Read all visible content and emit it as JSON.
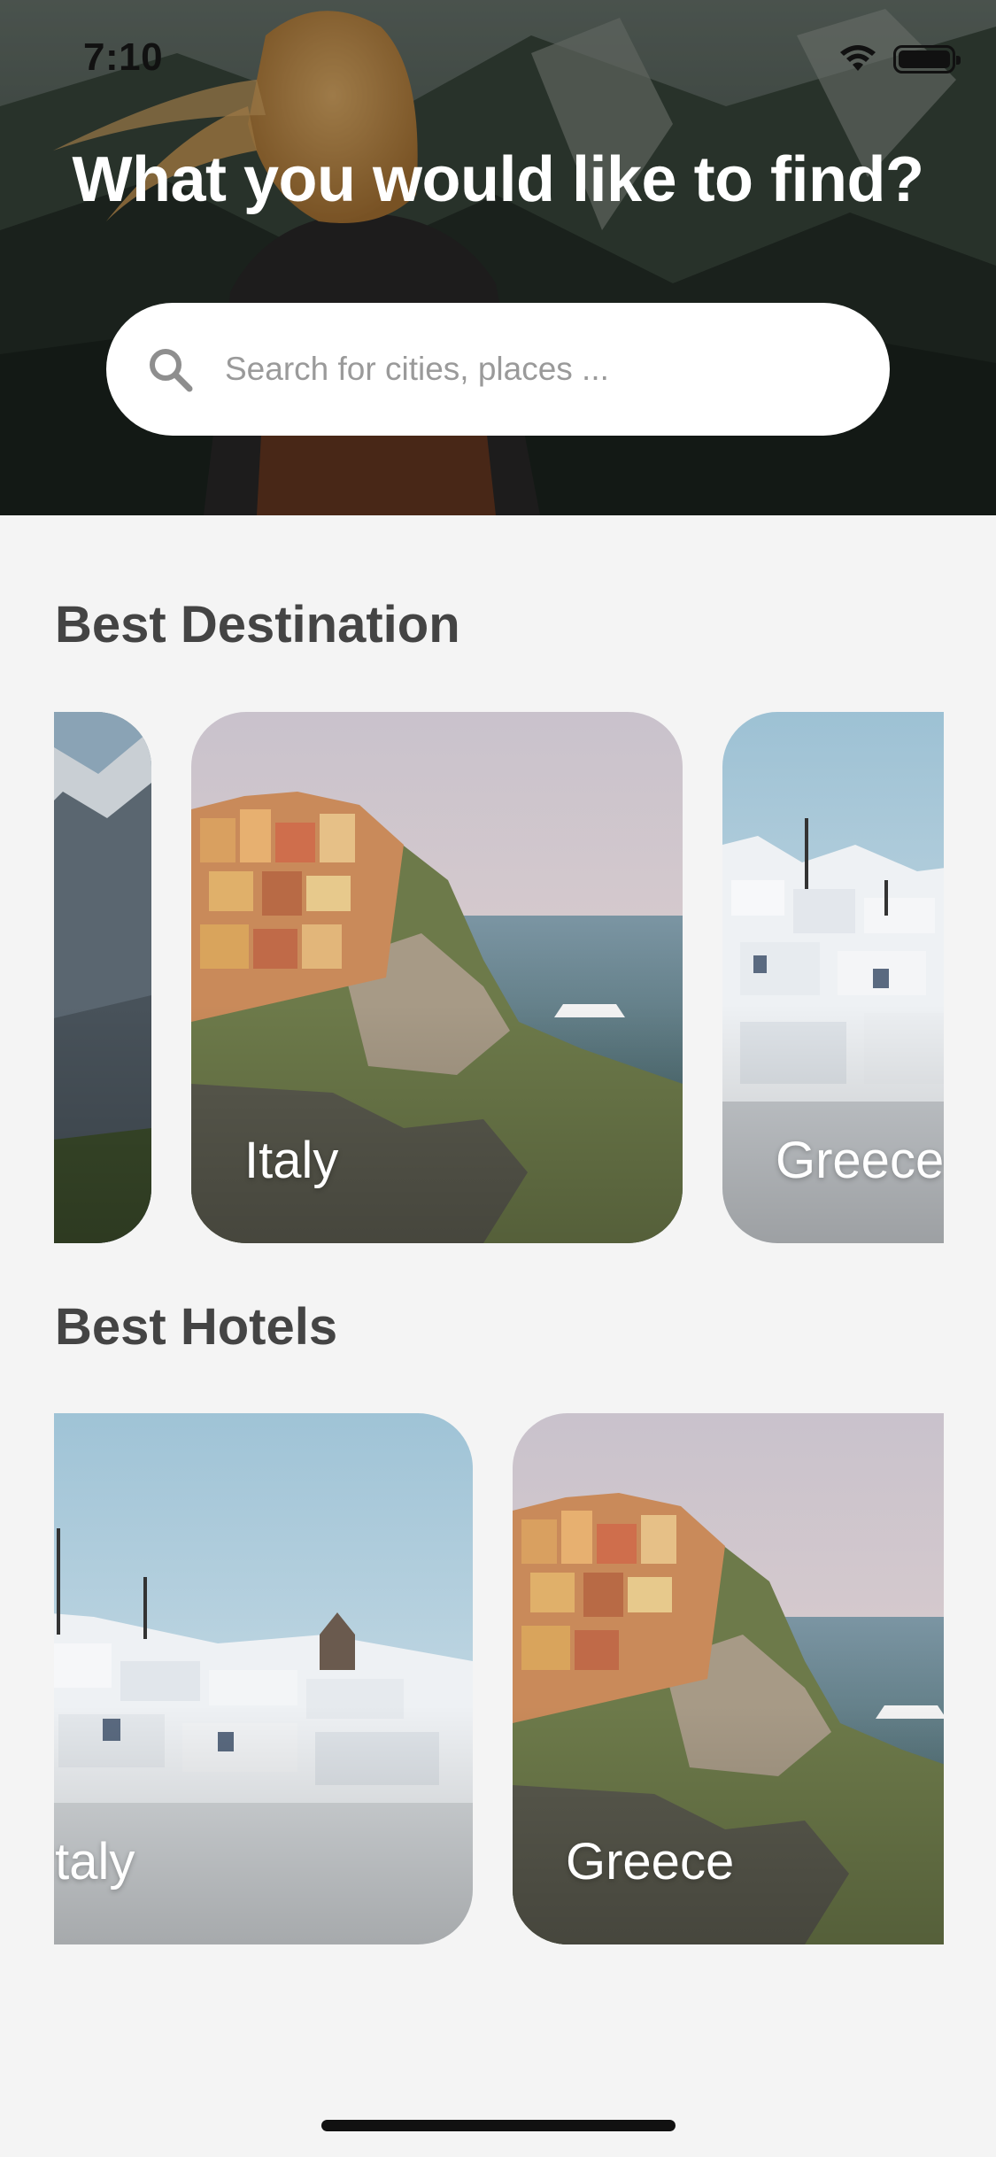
{
  "status_bar": {
    "time": "7:10"
  },
  "hero": {
    "title": "What you would like to find?",
    "search": {
      "placeholder": "Search for cities, places ...",
      "value": ""
    }
  },
  "best_destination": {
    "title": "Best Destination",
    "cards": [
      {
        "label": "",
        "scene": "mountains"
      },
      {
        "label": "Italy",
        "scene": "italy-cliff-town"
      },
      {
        "label": "Greece",
        "scene": "greece-white-town"
      }
    ]
  },
  "best_hotels": {
    "title": "Best Hotels",
    "cards": [
      {
        "label": "Italy",
        "scene": "greece-white-town"
      },
      {
        "label": "Greece",
        "scene": "italy-cliff-town"
      }
    ]
  },
  "colors": {
    "background": "#f4f4f4",
    "section_title": "#444444",
    "card_label": "#ffffff"
  }
}
